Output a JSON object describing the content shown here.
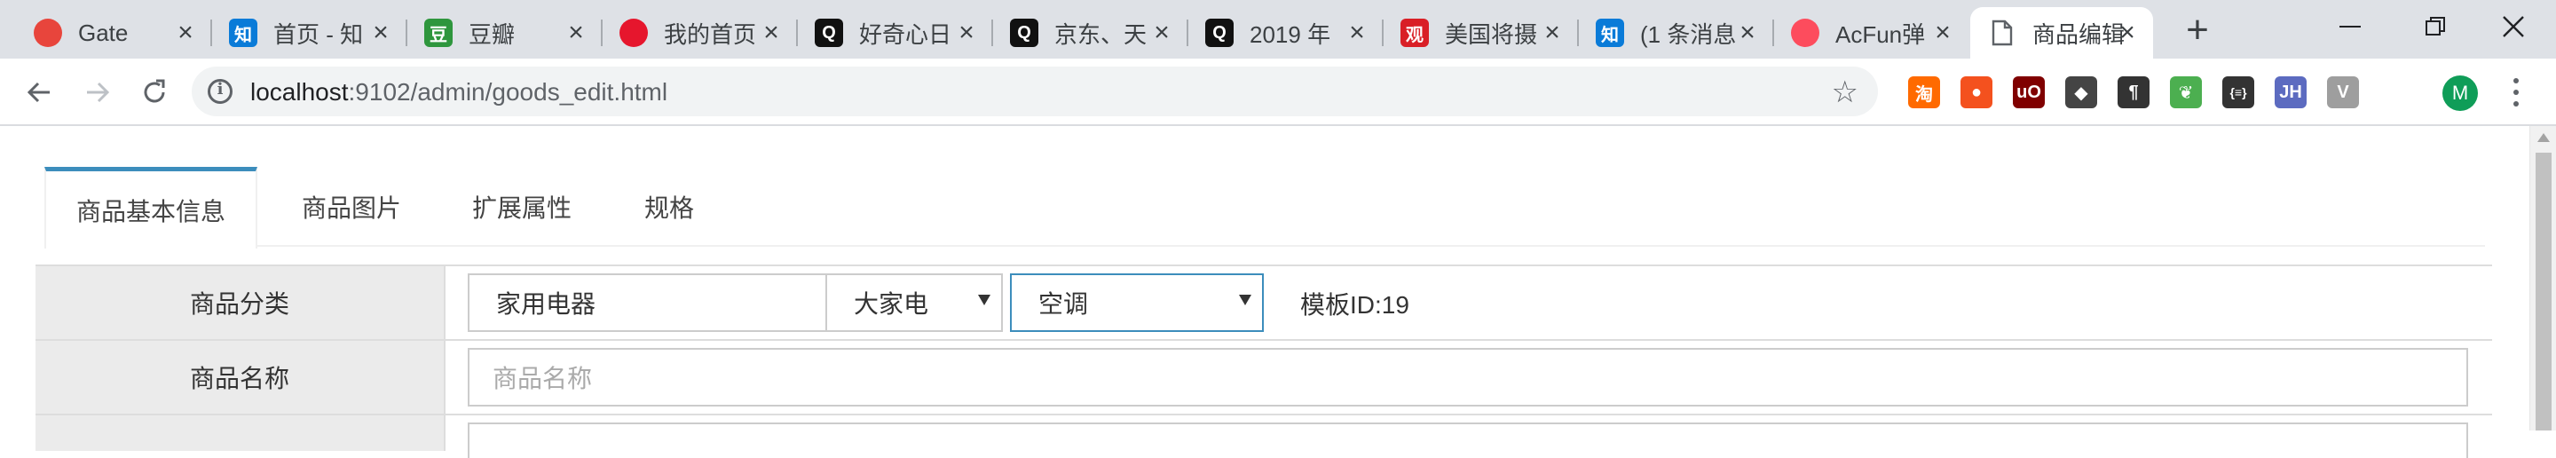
{
  "browser": {
    "tabs": [
      {
        "title": "Gate",
        "favicon_icon": "gate-favicon-icon",
        "color": "#e8453c"
      },
      {
        "title": "首页 - 知",
        "favicon_icon": "zhihu-favicon-icon",
        "color": "#0a7bd8",
        "glyph": "知"
      },
      {
        "title": "豆瓣",
        "favicon_icon": "douban-favicon-icon",
        "color": "#2e963d",
        "glyph": "豆"
      },
      {
        "title": "我的首页",
        "favicon_icon": "weibo-favicon-icon",
        "color": "#e6162d"
      },
      {
        "title": "好奇心日",
        "favicon_icon": "qdaily-favicon-icon",
        "color": "#111111",
        "glyph": "Q"
      },
      {
        "title": "京东、天",
        "favicon_icon": "qdaily-favicon-icon",
        "color": "#111111",
        "glyph": "Q"
      },
      {
        "title": "2019 年",
        "favicon_icon": "qdaily-favicon-icon",
        "color": "#111111",
        "glyph": "Q"
      },
      {
        "title": "美国将摄",
        "favicon_icon": "guancha-favicon-icon",
        "color": "#d91f26",
        "glyph": "观"
      },
      {
        "title": "(1 条消息",
        "favicon_icon": "zhihu-favicon-icon",
        "color": "#0a7bd8",
        "glyph": "知"
      },
      {
        "title": "AcFun弹",
        "favicon_icon": "acfun-favicon-icon",
        "color": "#fd4c5d"
      },
      {
        "title": "商品编辑",
        "favicon_icon": "page-favicon-icon",
        "color": "#ffffff",
        "active": true
      }
    ],
    "url": {
      "host": "localhost",
      "path": ":9102/admin/goods_edit.html"
    },
    "avatar_letter": "M",
    "extensions": [
      {
        "icon": "taobao-ext-icon",
        "color": "#ff6a00",
        "glyph": "淘"
      },
      {
        "icon": "map-pin-ext-icon",
        "color": "#f4511e",
        "glyph": "●"
      },
      {
        "icon": "ublock-ext-icon",
        "color": "#800000",
        "glyph": "uO"
      },
      {
        "icon": "spy-ext-icon",
        "color": "#444444",
        "glyph": "◆"
      },
      {
        "icon": "pilcrow-ext-icon",
        "color": "#333333",
        "glyph": "¶"
      },
      {
        "icon": "leaf-ext-icon",
        "color": "#4caf50",
        "glyph": "❦"
      },
      {
        "icon": "json-ext-icon",
        "color": "#333333",
        "glyph": "{≡}"
      },
      {
        "icon": "jh-ext-icon",
        "color": "#5c6bc0",
        "glyph": "JH"
      },
      {
        "icon": "vue-ext-icon",
        "color": "#9e9e9e",
        "glyph": "V"
      }
    ]
  },
  "page": {
    "tabs": [
      {
        "label": "商品基本信息",
        "active": true
      },
      {
        "label": "商品图片"
      },
      {
        "label": "扩展属性"
      },
      {
        "label": "规格"
      }
    ],
    "form": {
      "category": {
        "label": "商品分类",
        "level1": "家用电器",
        "level2": "大家电",
        "level3": "空调",
        "template_id_text": "模板ID:19"
      },
      "name": {
        "label": "商品名称",
        "placeholder": "商品名称"
      }
    }
  }
}
